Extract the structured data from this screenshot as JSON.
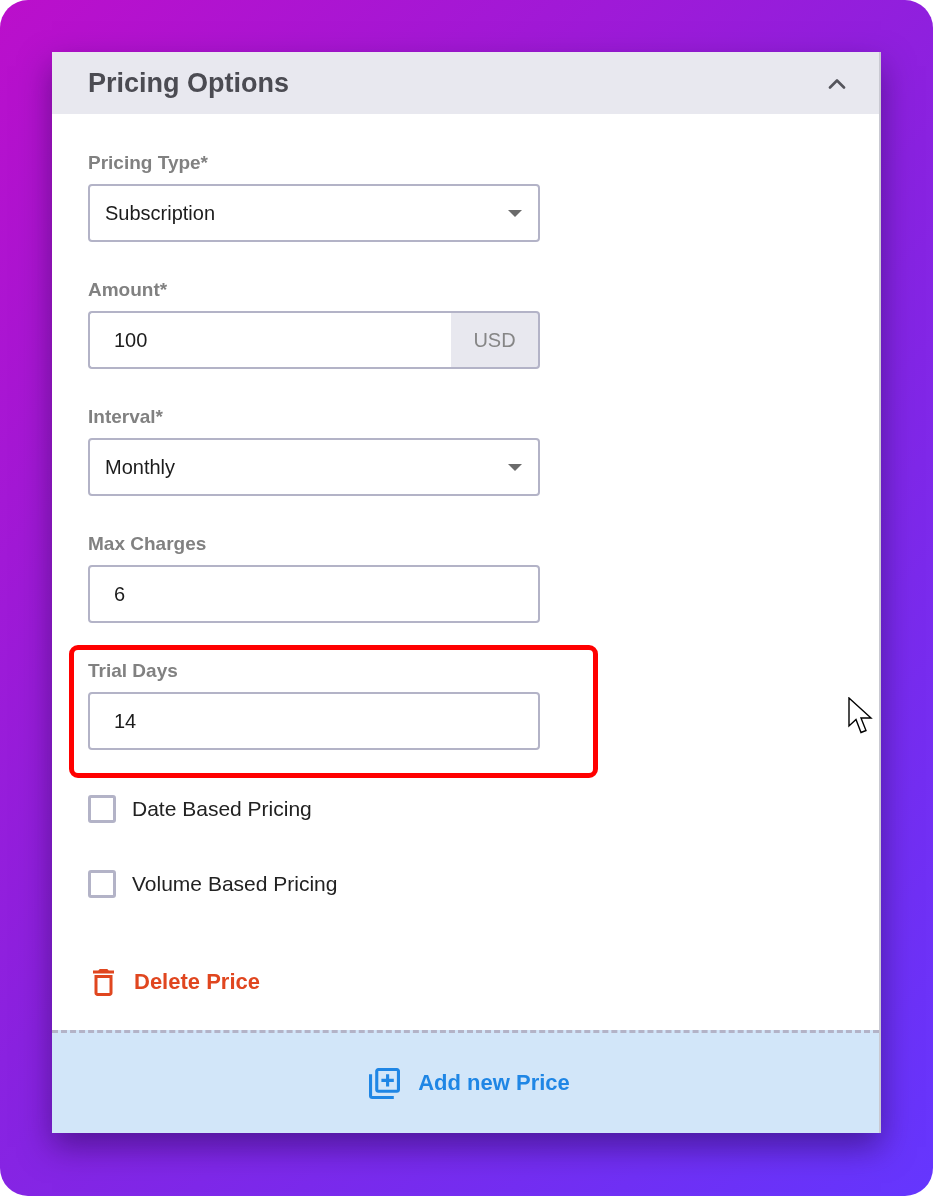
{
  "section": {
    "title": "Pricing Options",
    "expanded": true
  },
  "fields": [
    {
      "kind": "select",
      "label": "Pricing Type*",
      "value": "Subscription",
      "highlighted": false
    },
    {
      "kind": "currency",
      "label": "Amount*",
      "value": "100",
      "unit": "USD",
      "highlighted": false
    },
    {
      "kind": "select",
      "label": "Interval*",
      "value": "Monthly",
      "highlighted": false
    },
    {
      "kind": "text",
      "label": "Max Charges",
      "value": "6",
      "highlighted": false
    },
    {
      "kind": "text",
      "label": "Trial Days",
      "value": "14",
      "highlighted": true
    }
  ],
  "options": [
    {
      "label": "Date Based Pricing",
      "checked": false
    },
    {
      "label": "Volume Based Pricing",
      "checked": false
    }
  ],
  "delete_button": {
    "label": "Delete Price"
  },
  "add_button": {
    "label": "Add new Price"
  }
}
